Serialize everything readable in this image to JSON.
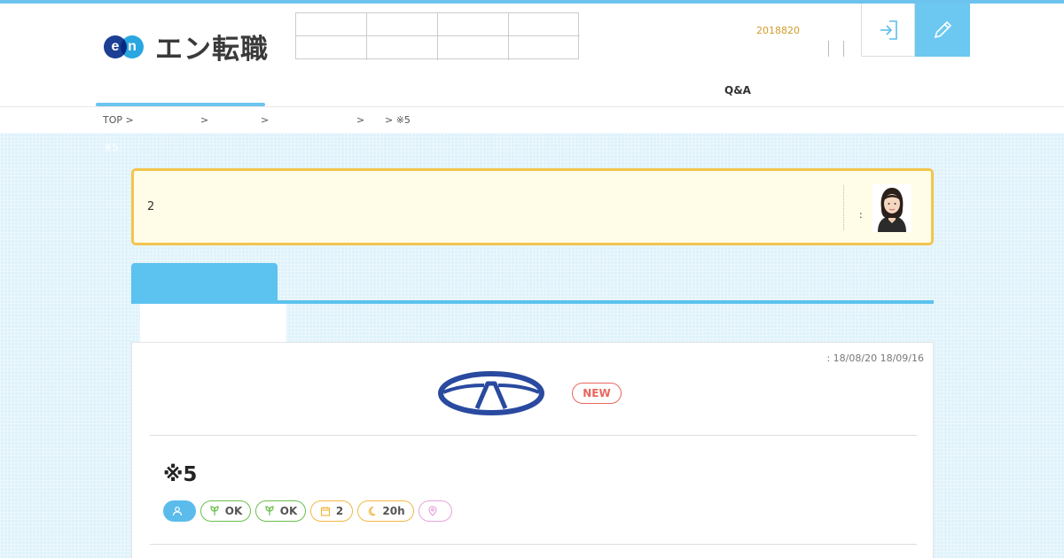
{
  "header": {
    "logo_en": [
      "e",
      "n"
    ],
    "logo_text": "エン転職",
    "categories": [
      "",
      "",
      "",
      "",
      "",
      "",
      "",
      ""
    ],
    "date_info": "2018820",
    "login_icon": "login-icon",
    "register_icon": "pencil-icon"
  },
  "nav": {
    "items": [
      {
        "label": ""
      },
      {
        "label": ""
      },
      {
        "label": ""
      },
      {
        "label": ""
      },
      {
        "label": "Q&A"
      },
      {
        "label": ""
      }
    ]
  },
  "breadcrumb": {
    "items": [
      "TOP >",
      ">",
      ">",
      ">",
      "> ※5"
    ]
  },
  "page": {
    "sub_title": "※5"
  },
  "notice": {
    "text": "2",
    "colon": ":"
  },
  "tabs": {
    "active_label": ""
  },
  "job": {
    "period": ": 18/08/20 18/09/16",
    "new_badge": "NEW",
    "title": "※5",
    "tags": [
      {
        "text": "",
        "icon": "person-icon",
        "color": "#5bbcec",
        "filled": true
      },
      {
        "text": "OK",
        "icon": "sprout-icon",
        "color": "#6abf4b",
        "filled": false
      },
      {
        "text": "OK",
        "icon": "sprout-icon",
        "color": "#6abf4b",
        "filled": false
      },
      {
        "text": "2",
        "icon": "calendar-icon",
        "color": "#f2b844",
        "filled": false
      },
      {
        "text": "20h",
        "icon": "moon-icon",
        "color": "#f2b844",
        "filled": false
      },
      {
        "text": "",
        "icon": "pin-icon",
        "color": "#e6a3dc",
        "filled": false
      }
    ]
  }
}
